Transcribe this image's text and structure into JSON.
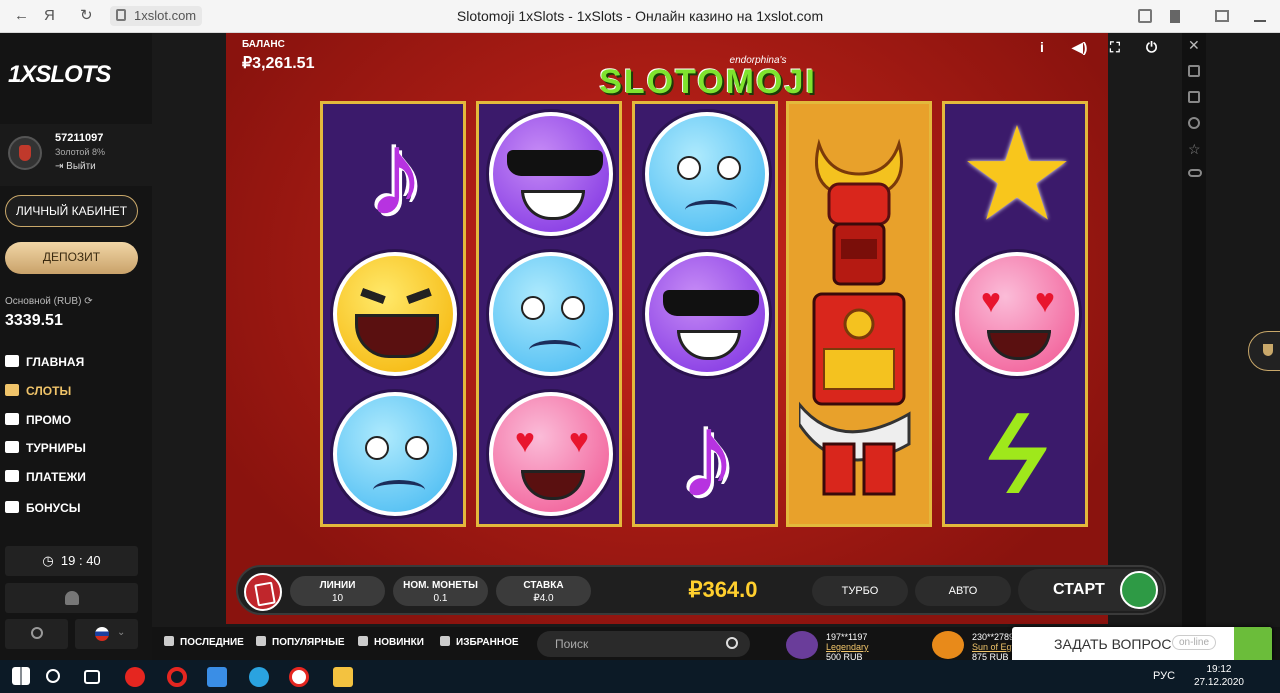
{
  "browser": {
    "back_label": "←",
    "ya_label": "Я",
    "refresh_label": "↻",
    "url": "1xslot.com",
    "title": "Slotomoji 1xSlots - 1xSlots - Онлайн казино на 1xslot.com"
  },
  "sidebar": {
    "logo": "1XSLOTS",
    "user_id": "57211097",
    "user_level": "Золотой 8%",
    "logout": "⇥ Выйти",
    "cabinet_btn": "ЛИЧНЫЙ КАБИНЕТ",
    "deposit_btn": "ДЕПОЗИТ",
    "account_label": "Основной (RUB)",
    "account_value": "3339.51",
    "nav": [
      {
        "label": "ГЛАВНАЯ",
        "icon": "home-icon"
      },
      {
        "label": "СЛОТЫ",
        "icon": "slots-icon"
      },
      {
        "label": "ПРОМО",
        "icon": "promo-icon"
      },
      {
        "label": "ТУРНИРЫ",
        "icon": "trophy-icon"
      },
      {
        "label": "ПЛАТЕЖИ",
        "icon": "wallet-icon"
      },
      {
        "label": "БОНУСЫ",
        "icon": "gift-icon"
      }
    ],
    "clock": "19 : 40"
  },
  "game": {
    "balance_label": "БАЛАНС",
    "balance_value": "₽3,261.51",
    "brand": "endorphina's",
    "title": "SLOTOMOJI",
    "info_label": "i",
    "reels": [
      [
        "music-note",
        "laughing",
        "sad-blue"
      ],
      [
        "cool-purple",
        "sad-blue",
        "heart-eyes"
      ],
      [
        "sad-blue",
        "cool-purple",
        "music-note"
      ],
      [
        "samurai"
      ],
      [
        "star",
        "heart-eyes",
        "lightning"
      ]
    ],
    "lines_label": "ЛИНИИ",
    "lines_value": "10",
    "coin_label": "НОМ. МОНЕТЫ",
    "coin_value": "0.1",
    "bet_label": "СТАВКА",
    "bet_value": "₽4.0",
    "total_bet": "₽364.0",
    "turbo_label": "ТУРБО",
    "auto_label": "АВТО",
    "start_label": "СТАРТ"
  },
  "bottom": {
    "tabs": [
      "ПОСЛЕДНИЕ",
      "ПОПУЛЯРНЫЕ",
      "НОВИНКИ",
      "ИЗБРАННОЕ"
    ],
    "search_placeholder": "Поиск",
    "wins": [
      {
        "user": "197**1197",
        "game": "Legendary",
        "amount": "500 RUB"
      },
      {
        "user": "230**2789",
        "game": "Sun of Egy",
        "amount": "875 RUB"
      }
    ],
    "ask_label": "ЗАДАТЬ ВОПРОС",
    "ask_status": "on-line"
  },
  "taskbar": {
    "lang": "РУС",
    "time": "19:12",
    "date": "27.12.2020"
  }
}
